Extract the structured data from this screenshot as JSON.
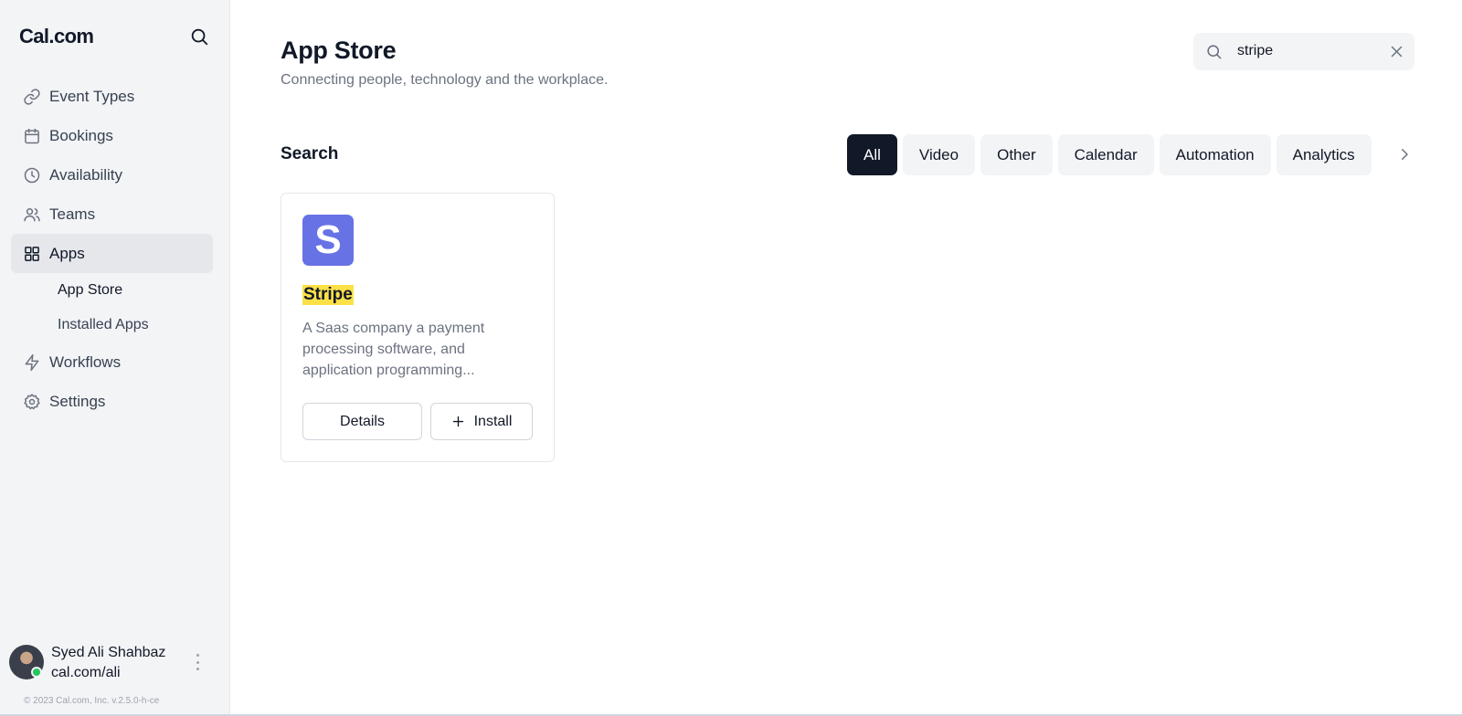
{
  "sidebar": {
    "logo": "Cal.com",
    "items": [
      {
        "label": "Event Types",
        "icon": "link-icon"
      },
      {
        "label": "Bookings",
        "icon": "calendar-icon"
      },
      {
        "label": "Availability",
        "icon": "clock-icon"
      },
      {
        "label": "Teams",
        "icon": "users-icon"
      },
      {
        "label": "Apps",
        "icon": "grid-icon",
        "active": true
      },
      {
        "label": "Workflows",
        "icon": "zap-icon"
      },
      {
        "label": "Settings",
        "icon": "gear-icon"
      }
    ],
    "sub_items": [
      {
        "label": "App Store",
        "active": true
      },
      {
        "label": "Installed Apps"
      }
    ],
    "user": {
      "name": "Syed Ali Shahbaz",
      "url": "cal.com/ali"
    },
    "copyright": "© 2023 Cal.com, Inc. v.2.5.0-h-ce"
  },
  "header": {
    "title": "App Store",
    "subtitle": "Connecting people, technology and the workplace."
  },
  "search": {
    "value": "stripe"
  },
  "section": {
    "title": "Search"
  },
  "filters": [
    "All",
    "Video",
    "Other",
    "Calendar",
    "Automation",
    "Analytics"
  ],
  "active_filter": "All",
  "apps": [
    {
      "logo_letter": "S",
      "name": "Stripe",
      "description": "A Saas company a payment processing software, and application programming...",
      "details_label": "Details",
      "install_label": "Install"
    }
  ],
  "colors": {
    "accent": "#111827",
    "stripe_brand": "#6772e5",
    "highlight": "#fde047",
    "presence": "#22c55e"
  }
}
